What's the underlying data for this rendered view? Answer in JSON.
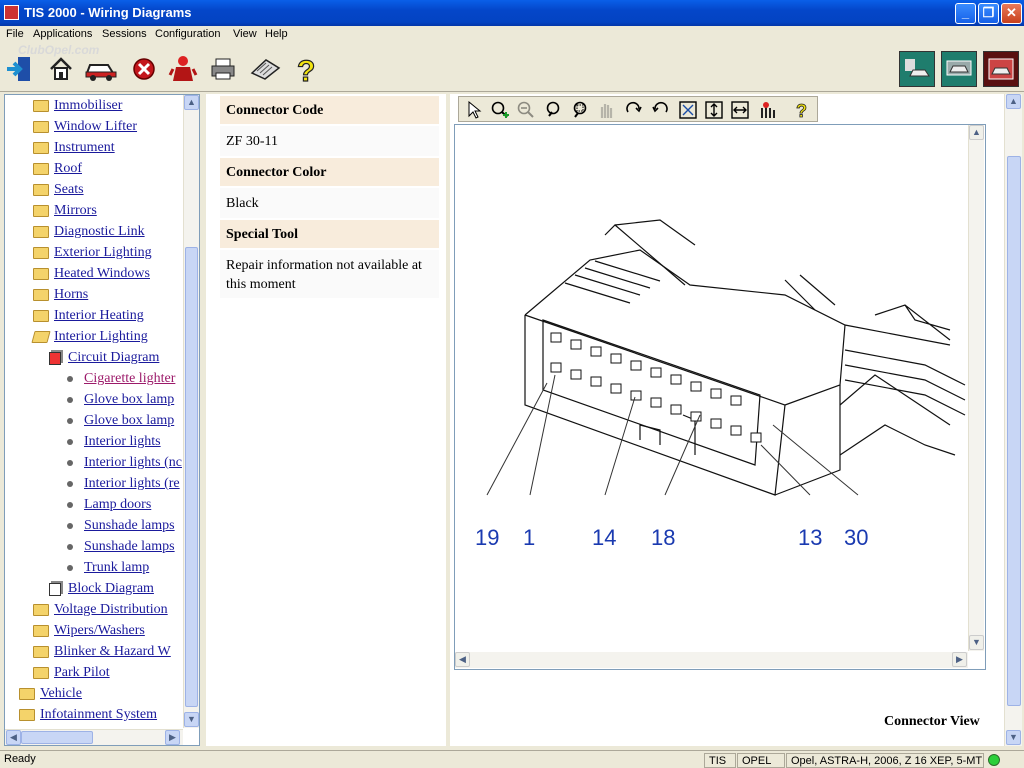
{
  "window": {
    "title": "TIS 2000 - Wiring Diagrams",
    "minimize": "_",
    "restore": "❐",
    "close": "✕"
  },
  "menu": [
    "File",
    "Applications",
    "Sessions",
    "Configuration",
    "View",
    "Help"
  ],
  "watermark": "ClubOpel.com",
  "toolbar": {
    "icons": [
      "exit-icon",
      "home-icon",
      "car-icon",
      "stop-icon",
      "user-icon",
      "printer-icon",
      "keyboard-icon",
      "help-icon"
    ],
    "right_icons": [
      "car-diagnostics-icon",
      "car-wiring-icon",
      "car-parts-icon"
    ]
  },
  "tree": {
    "items": [
      {
        "label": "Immobiliser",
        "type": "folder",
        "level": 2
      },
      {
        "label": "Window Lifter",
        "type": "folder",
        "level": 2
      },
      {
        "label": "Instrument",
        "type": "folder",
        "level": 2
      },
      {
        "label": "Roof",
        "type": "folder",
        "level": 2
      },
      {
        "label": "Seats",
        "type": "folder",
        "level": 2
      },
      {
        "label": "Mirrors",
        "type": "folder",
        "level": 2
      },
      {
        "label": "Diagnostic Link",
        "type": "folder",
        "level": 2
      },
      {
        "label": "Exterior Lighting",
        "type": "folder",
        "level": 2
      },
      {
        "label": "Heated Windows",
        "type": "folder",
        "level": 2
      },
      {
        "label": "Horns",
        "type": "folder",
        "level": 2
      },
      {
        "label": "Interior Heating",
        "type": "folder",
        "level": 2
      },
      {
        "label": "Interior Lighting",
        "type": "open-folder",
        "level": 2
      },
      {
        "label": "Circuit Diagram",
        "type": "book-open",
        "level": 3
      },
      {
        "label": "Cigarette lighter",
        "type": "bullet",
        "level": 4,
        "active": true
      },
      {
        "label": "Glove box lamp",
        "type": "bullet",
        "level": 4
      },
      {
        "label": "Glove box lamp",
        "type": "bullet",
        "level": 4
      },
      {
        "label": "Interior lights",
        "type": "bullet",
        "level": 4
      },
      {
        "label": "Interior lights (nc",
        "type": "bullet",
        "level": 4
      },
      {
        "label": "Interior lights (re",
        "type": "bullet",
        "level": 4
      },
      {
        "label": "Lamp doors",
        "type": "bullet",
        "level": 4
      },
      {
        "label": "Sunshade lamps",
        "type": "bullet",
        "level": 4
      },
      {
        "label": "Sunshade lamps",
        "type": "bullet",
        "level": 4
      },
      {
        "label": "Trunk lamp",
        "type": "bullet",
        "level": 4
      },
      {
        "label": "Block Diagram",
        "type": "book",
        "level": 3
      },
      {
        "label": "Voltage Distribution",
        "type": "folder",
        "level": 2
      },
      {
        "label": "Wipers/Washers",
        "type": "folder",
        "level": 2
      },
      {
        "label": "Blinker & Hazard W",
        "type": "folder",
        "level": 2
      },
      {
        "label": "Park Pilot",
        "type": "folder",
        "level": 2
      },
      {
        "label": "Vehicle",
        "type": "folder",
        "level": 1
      },
      {
        "label": "Infotainment System",
        "type": "folder",
        "level": 1
      }
    ]
  },
  "info": {
    "connector_code_label": "Connector Code",
    "connector_code": "ZF 30-11",
    "connector_color_label": "Connector Color",
    "connector_color": "Black",
    "special_tool_label": "Special Tool",
    "special_tool": "Repair information not available at this moment"
  },
  "viewer": {
    "tools": [
      "select-arrow-icon",
      "zoom-in-icon",
      "zoom-out-icon",
      "zoom-icon",
      "zoom-area-icon",
      "pan-hand-icon",
      "rotate-cw-icon",
      "rotate-ccw-icon",
      "fit-all-icon",
      "fit-height-icon",
      "fit-width-icon",
      "highlight-icon",
      "help-icon"
    ],
    "pin_labels": [
      "19",
      "1",
      "14",
      "18",
      "13",
      "30"
    ],
    "caption": "Connector View"
  },
  "status": {
    "text": "Ready",
    "app": "TIS",
    "brand": "OPEL",
    "vehicle": "Opel, ASTRA-H, 2006, Z 16 XEP, 5-MT",
    "indicator_color": "#2bcf3a"
  },
  "scroll_arrows": {
    "up": "▲",
    "down": "▼",
    "left": "◀",
    "right": "▶"
  }
}
